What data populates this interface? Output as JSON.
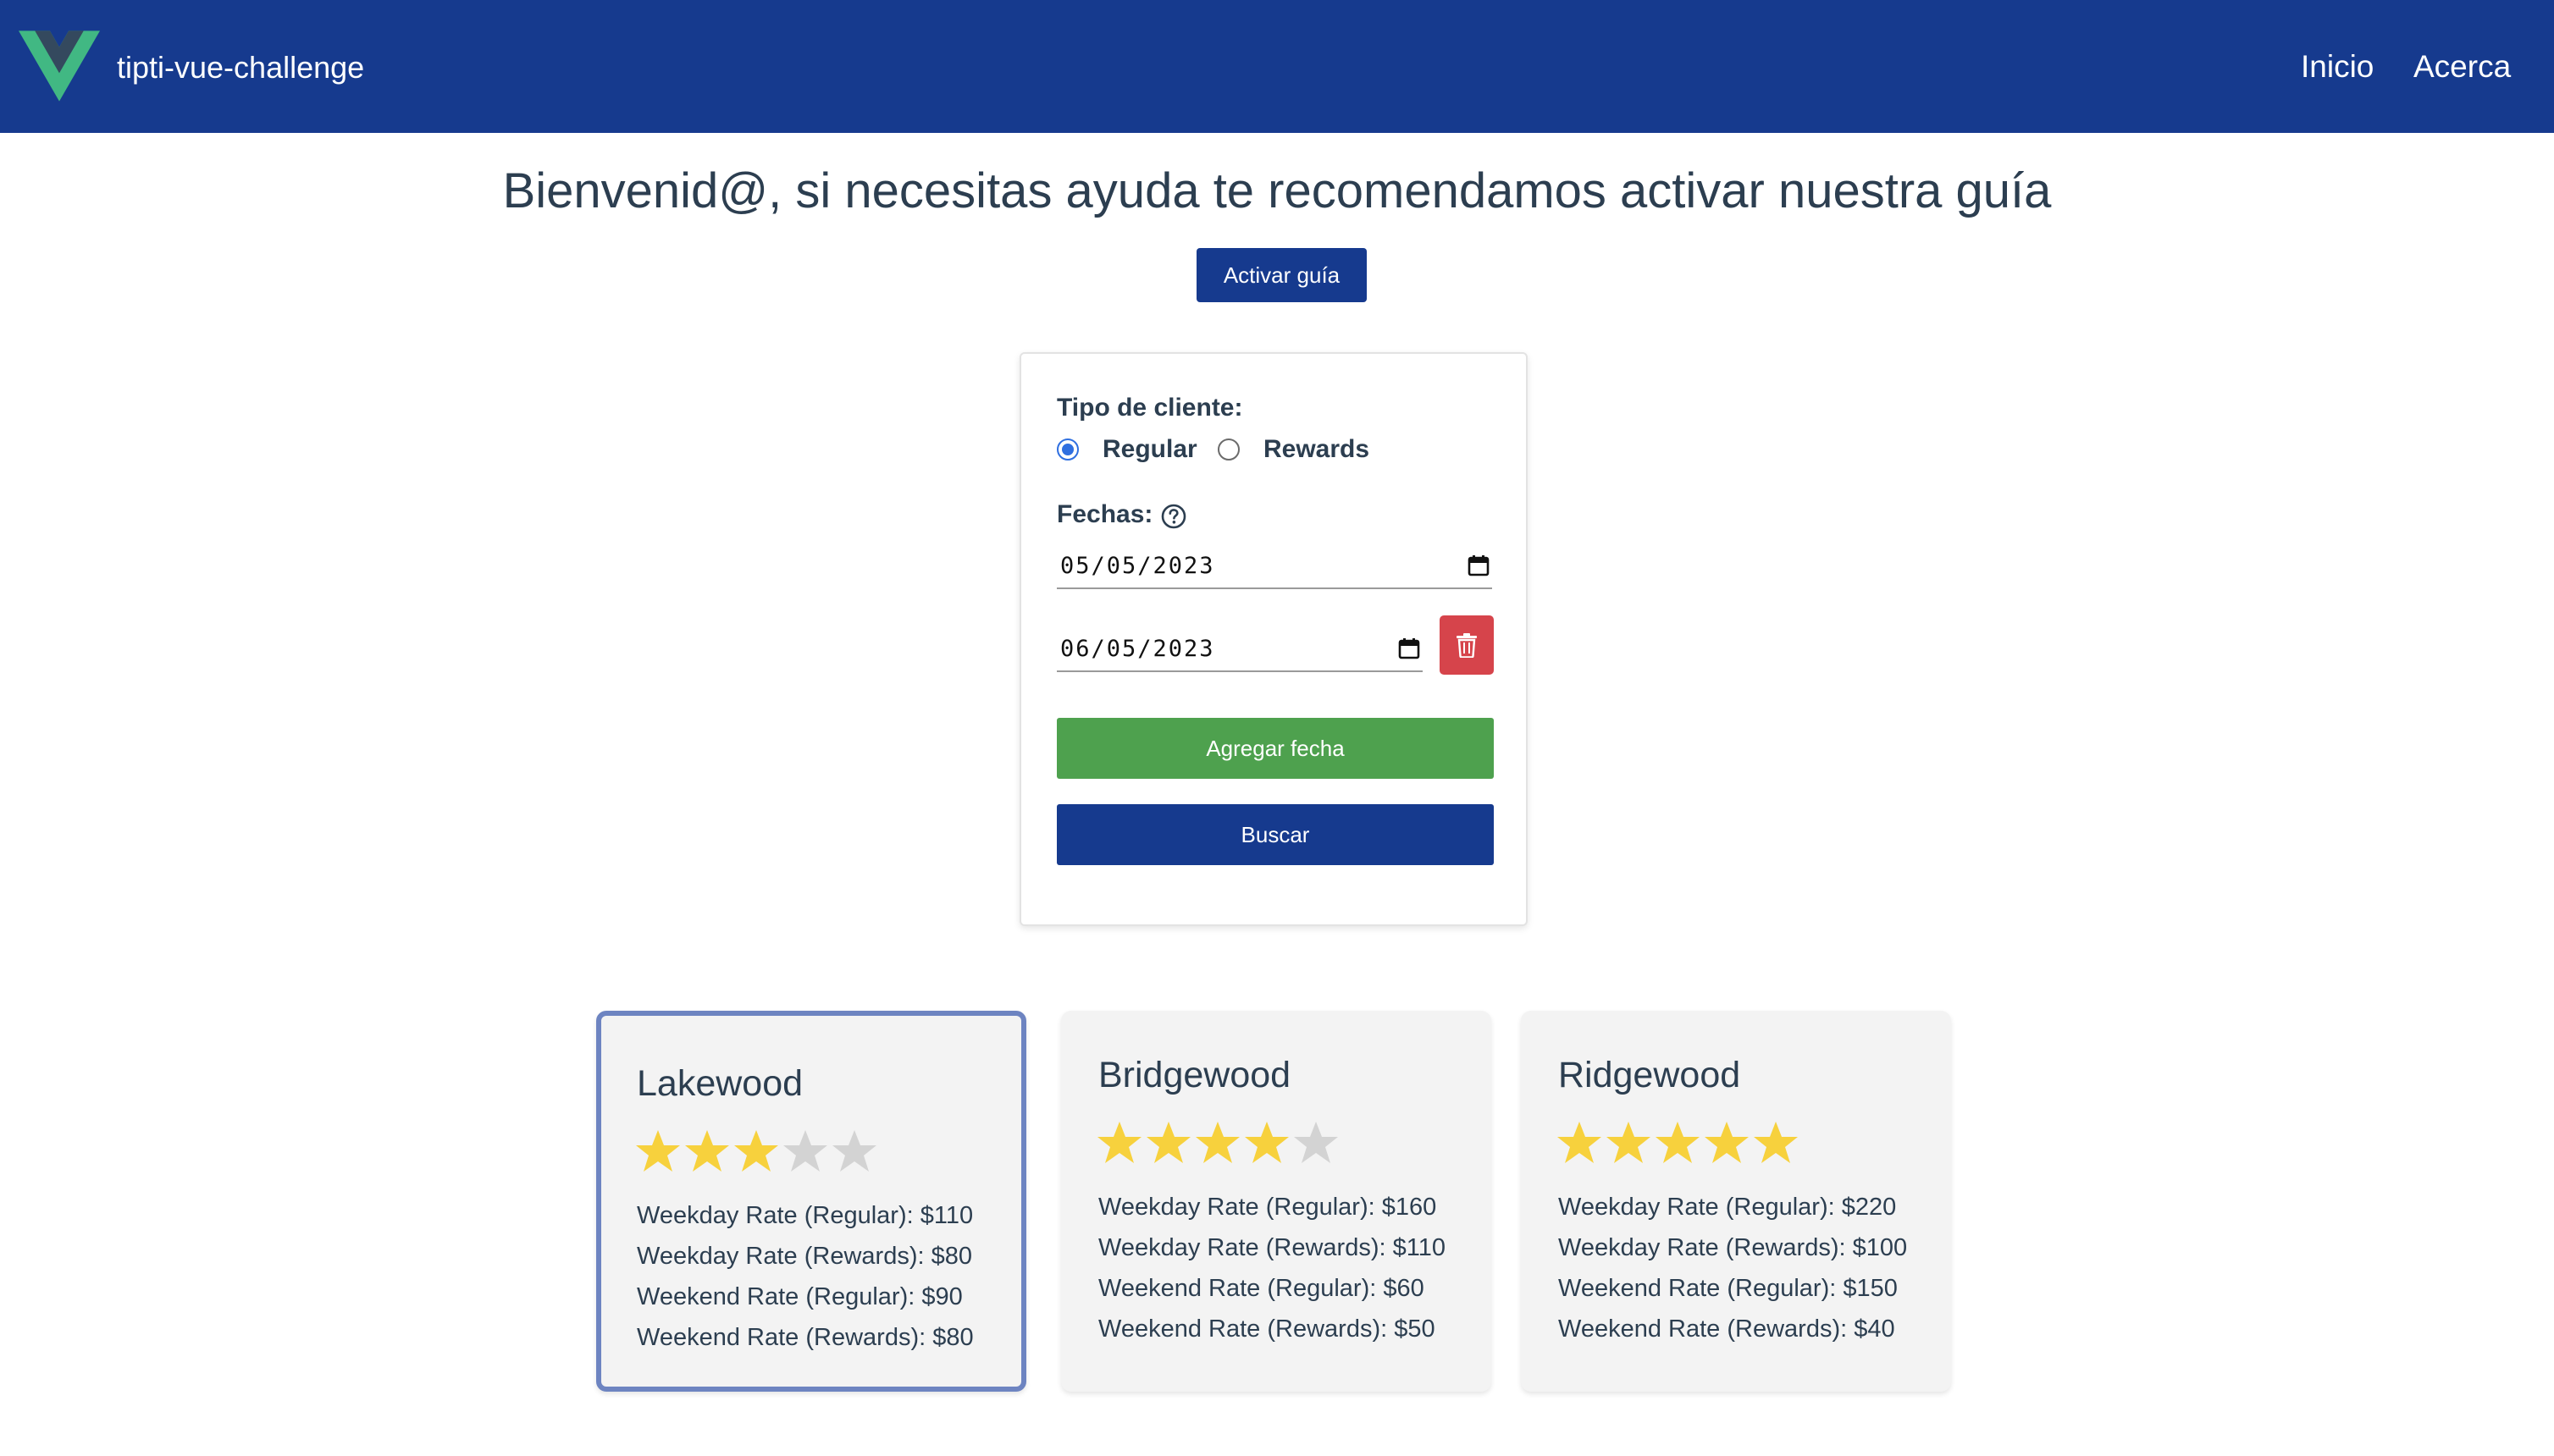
{
  "navbar": {
    "brand": "tipti-vue-challenge",
    "links": [
      "Inicio",
      "Acerca"
    ],
    "logo_icon": "vue-logo-icon",
    "background": "#163a8e"
  },
  "welcome": {
    "message": "Bienvenid@, si necesitas ayuda te recomendamos activar nuestra guía",
    "guide_button": "Activar guía"
  },
  "form": {
    "client_type_label": "Tipo de cliente:",
    "client_types": [
      {
        "label": "Regular",
        "selected": true
      },
      {
        "label": "Rewards",
        "selected": false
      }
    ],
    "dates_label": "Fechas:",
    "dates": [
      "05/05/2023",
      "06/05/2023"
    ],
    "add_date_button": "Agregar fecha",
    "search_button": "Buscar",
    "colors": {
      "add": "#4ea14e",
      "search": "#163a8e",
      "delete": "#d6444b"
    }
  },
  "hotels": [
    {
      "name": "Lakewood",
      "rating": 3,
      "max_rating": 5,
      "selected": true,
      "rates": [
        "Weekday Rate (Regular): $110",
        "Weekday Rate (Rewards): $80",
        "Weekend Rate (Regular): $90",
        "Weekend Rate (Rewards): $80"
      ]
    },
    {
      "name": "Bridgewood",
      "rating": 4,
      "max_rating": 5,
      "selected": false,
      "rates": [
        "Weekday Rate (Regular): $160",
        "Weekday Rate (Rewards): $110",
        "Weekend Rate (Regular): $60",
        "Weekend Rate (Rewards): $50"
      ]
    },
    {
      "name": "Ridgewood",
      "rating": 5,
      "max_rating": 5,
      "selected": false,
      "rates": [
        "Weekday Rate (Regular): $220",
        "Weekday Rate (Rewards): $100",
        "Weekend Rate (Regular): $150",
        "Weekend Rate (Rewards): $40"
      ]
    }
  ]
}
